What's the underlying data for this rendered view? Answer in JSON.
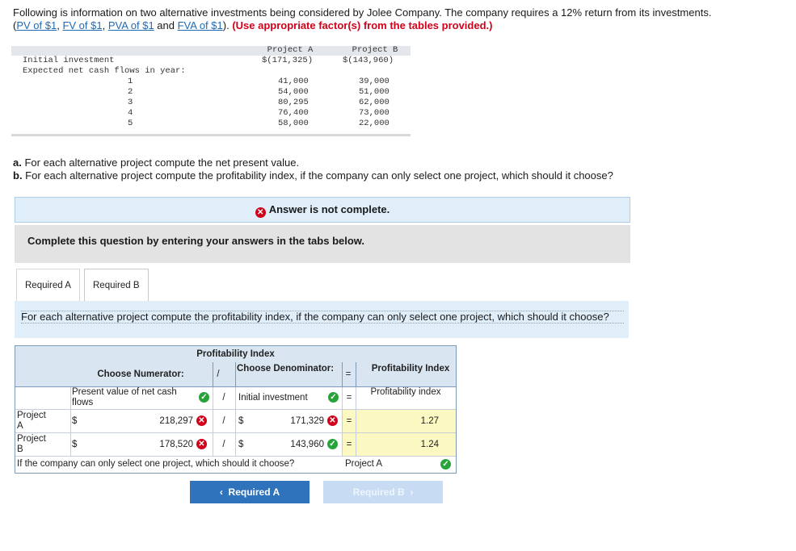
{
  "intro": {
    "text1": "Following is information on two alternative investments being considered by Jolee Company. The company requires a 12% return from its investments. (",
    "links": [
      "PV of $1",
      "FV of $1",
      "PVA of $1",
      "FVA of $1"
    ],
    "sep1": ", ",
    "sep2": ", ",
    "sep3": " and ",
    "text2": "). ",
    "red_note": "(Use appropriate factor(s) from the tables provided.)"
  },
  "investments": {
    "col_a": "Project A",
    "col_b": "Project B",
    "initial_label": "Initial investment",
    "initial_a": "$(171,325)",
    "initial_b": "$(143,960)",
    "cash_label": "Expected net cash flows in year:",
    "years": [
      {
        "year": "1",
        "a": "41,000",
        "b": "39,000"
      },
      {
        "year": "2",
        "a": "54,000",
        "b": "51,000"
      },
      {
        "year": "3",
        "a": "80,295",
        "b": "62,000"
      },
      {
        "year": "4",
        "a": "76,400",
        "b": "73,000"
      },
      {
        "year": "5",
        "a": "58,000",
        "b": "22,000"
      }
    ]
  },
  "questions": {
    "a_letter": "a.",
    "a_text": " For each alternative project compute the net present value.",
    "b_letter": "b.",
    "b_text": " For each alternative project compute the profitability index, if the company can only select one project, which should it choose?"
  },
  "banner": {
    "text": "Answer is not complete."
  },
  "complete_box": {
    "text": "Complete this question by entering your answers in the tabs below."
  },
  "tabs": [
    "Required A",
    "Required B"
  ],
  "instruction": "For each alternative project compute the profitability index, if the company can only select one project, which should it choose?",
  "pi_table": {
    "title": "Profitability Index",
    "hdr_num": "Choose Numerator:",
    "hdr_div": "/",
    "hdr_den": "Choose Denominator:",
    "hdr_eq": "=",
    "hdr_pi": "Profitability Index",
    "sel_num": "Present value of net cash flows",
    "sel_div": "/",
    "sel_den": "Initial investment",
    "sel_eq": "=",
    "sel_pi": "Profitability index",
    "rows": [
      {
        "label": "Project A",
        "cur1": "$",
        "num": "218,297",
        "div": "/",
        "cur2": "$",
        "den": "171,329",
        "eq": "=",
        "pi": "1.27"
      },
      {
        "label": "Project B",
        "cur1": "$",
        "num": "178,520",
        "div": "/",
        "cur2": "$",
        "den": "143,960",
        "eq": "=",
        "pi": "1.24"
      }
    ],
    "choose_q": "If the company can only select one project, which should it choose?",
    "choose_a": "Project A"
  },
  "nav": {
    "prev": "Required A",
    "next": "Required B"
  }
}
